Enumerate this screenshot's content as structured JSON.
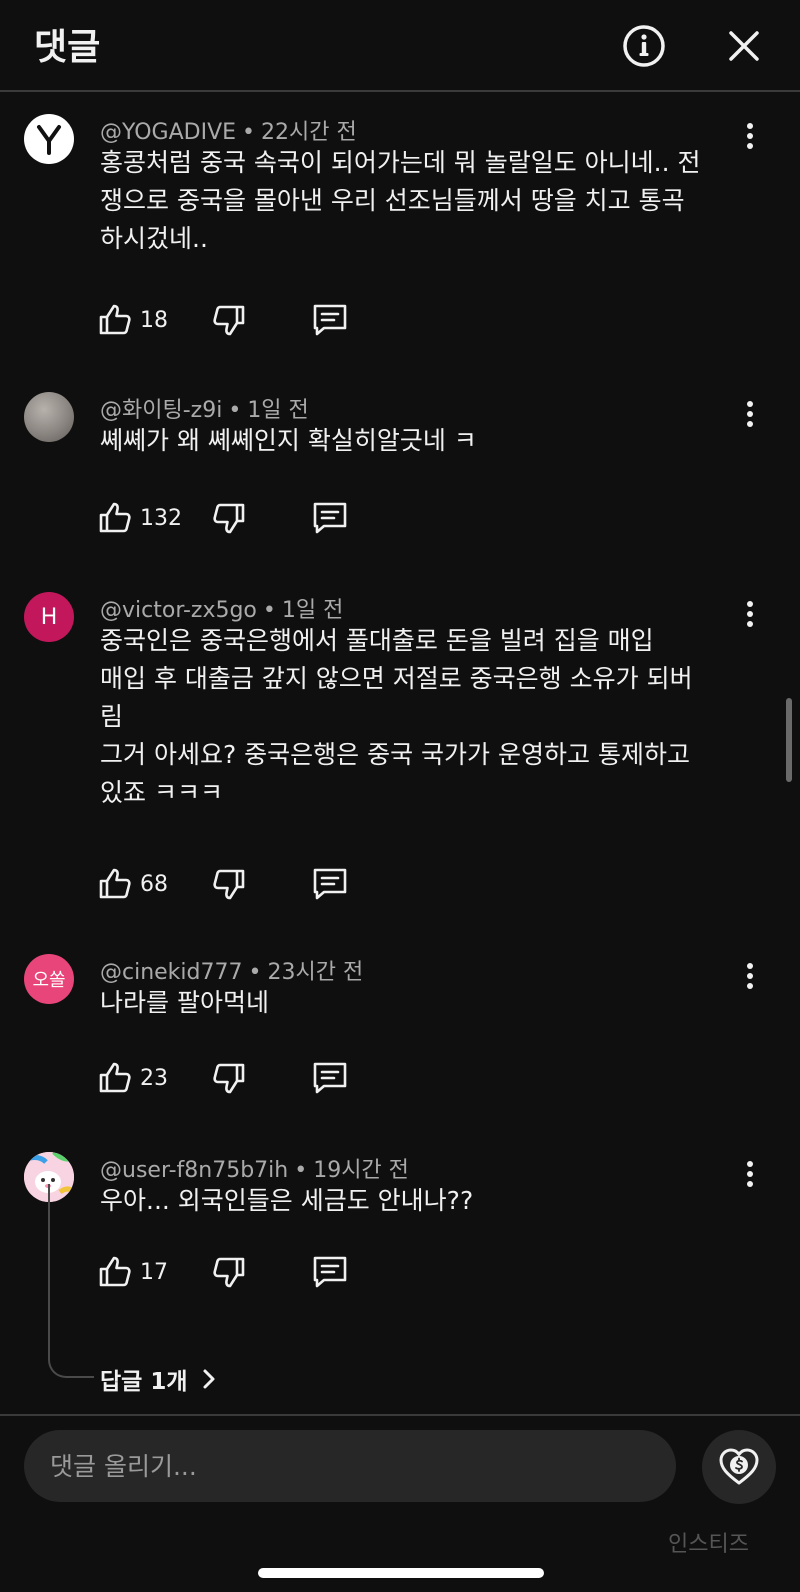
{
  "header": {
    "title": "댓글",
    "info_icon": "info-circle-icon",
    "close_icon": "close-icon"
  },
  "comments": [
    {
      "author": "@YOGADIVE",
      "time": "22시간 전",
      "lines": [
        "홍콩처럼 중국 속국이 되어가는데 뭐 놀랄일도 아니네.. 전",
        "쟁으로 중국을 몰아낸 우리 선조님들께서 땅을 치고 통곡",
        "하시겄네.."
      ],
      "likes": "18",
      "avatar_letter": "Y",
      "avatar_color": "#ffffff"
    },
    {
      "author": "@화이팅-z9i",
      "time": "1일 전",
      "lines": [
        "쎼쎼가 왜 쎼쎼인지 확실히알긋네 ㅋ"
      ],
      "likes": "132",
      "avatar_letter": "",
      "avatar_color": "#8a8580"
    },
    {
      "author": "@victor-zx5go",
      "time": "1일 전",
      "lines": [
        "중국인은 중국은행에서 풀대출로 돈을 빌려 집을 매입",
        "매입 후 대출금 갚지 않으면 저절로 중국은행 소유가 되버",
        "림",
        "그거 아세요? 중국은행은 중국 국가가 운영하고 통제하고",
        "있죠 ㅋㅋㅋ"
      ],
      "likes": "68",
      "avatar_letter": "H",
      "avatar_color": "#c2185b"
    },
    {
      "author": "@cinekid777",
      "time": "23시간 전",
      "lines": [
        "나라를 팔아먹네"
      ],
      "likes": "23",
      "avatar_letter": "오쏠",
      "avatar_color": "#e8457a"
    },
    {
      "author": "@user-f8n75b7ih",
      "time": "19시간 전",
      "lines": [
        "우아... 외국인들은 세금도 안내나??"
      ],
      "likes": "17",
      "avatar_letter": "",
      "avatar_color": "#f3a6c8"
    }
  ],
  "replies_link": "답글 1개",
  "input": {
    "placeholder": "댓글 올리기..."
  },
  "thanks_icon": "heart-dollar-icon",
  "watermark": "인스티즈",
  "icons": {
    "like": "thumbs-up-icon",
    "dislike": "thumbs-down-icon",
    "reply": "comment-icon",
    "more": "more-vertical-icon"
  }
}
